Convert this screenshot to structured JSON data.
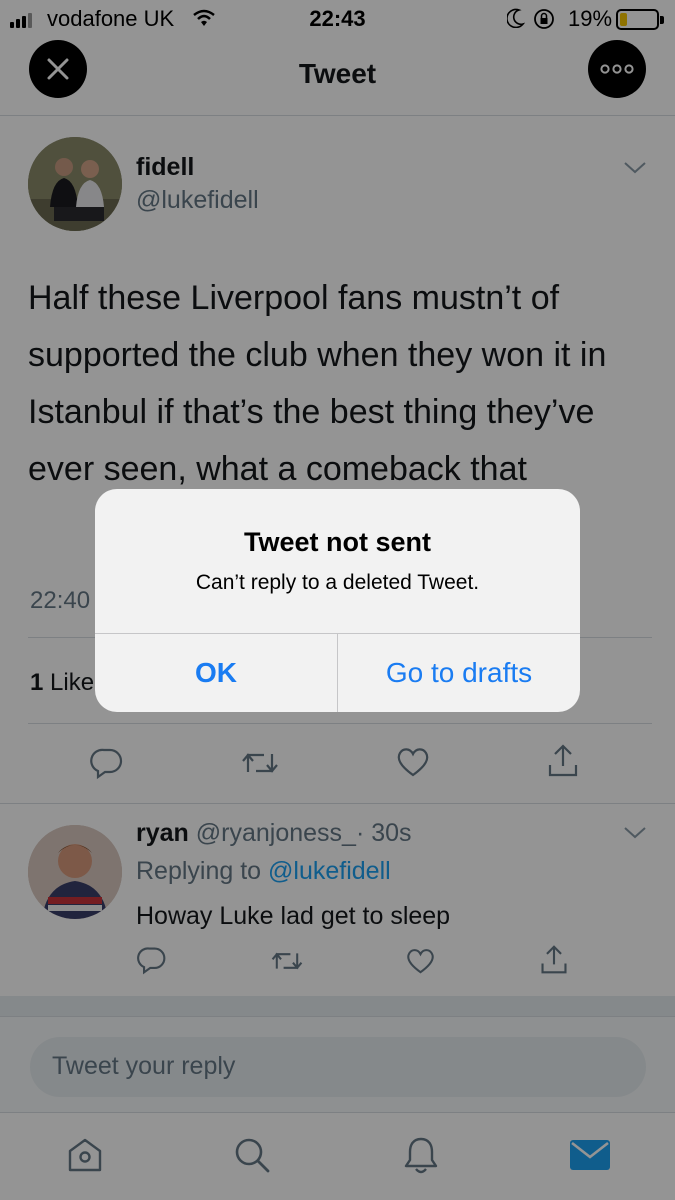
{
  "status_bar": {
    "carrier": "vodafone UK",
    "time": "22:43",
    "battery_percent": "19%",
    "battery_level": 0.19
  },
  "header": {
    "title": "Tweet",
    "close_icon": "close-icon",
    "more_icon": "more-options-icon"
  },
  "tweet": {
    "author_name": "fidell",
    "author_handle": "@lukefidell",
    "text": "Half these Liverpool fans mustn’t of supported the club when they won it in Istanbul if that’s the best thing they’ve ever seen, what a comeback that",
    "time_partial": "22:40",
    "likes_count": "1",
    "likes_label": "Like"
  },
  "reply": {
    "author_name": "ryan",
    "author_handle": "@ryanjoness_",
    "age": "· 30s",
    "replying_prefix": "Replying to",
    "replying_to": "@lukefidell",
    "text": "Howay Luke lad get to sleep"
  },
  "composer": {
    "placeholder": "Tweet your reply"
  },
  "tabbar": {
    "items": [
      "home-icon",
      "search-icon",
      "notifications-icon",
      "messages-icon"
    ],
    "active": "messages-icon"
  },
  "alert": {
    "title": "Tweet not sent",
    "message": "Can’t reply to a deleted Tweet.",
    "ok_label": "OK",
    "drafts_label": "Go to drafts"
  },
  "colors": {
    "accent": "#1da1f2",
    "alert_button": "#1a7cf2",
    "secondary_text": "#657786"
  }
}
